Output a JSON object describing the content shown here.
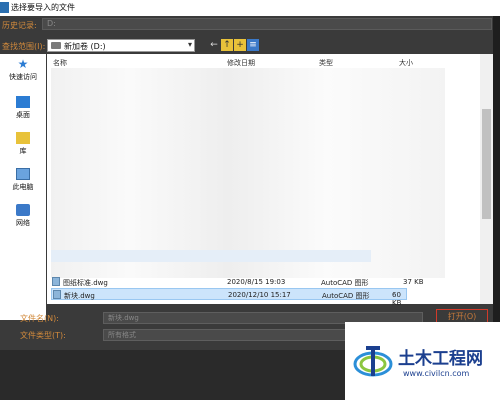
{
  "window": {
    "title": "选择要导入的文件"
  },
  "history": {
    "label": "历史记录:",
    "value": "D:"
  },
  "lookin": {
    "label": "查找范围(I):",
    "value": "新加卷 (D:)"
  },
  "toolbar": {
    "back": "←",
    "up": "↑",
    "new_folder": "+",
    "views": "≡"
  },
  "places": [
    {
      "label": "快速访问",
      "icon": "star-icon"
    },
    {
      "label": "桌面",
      "icon": "desktop-icon"
    },
    {
      "label": "库",
      "icon": "library-icon"
    },
    {
      "label": "此电脑",
      "icon": "computer-icon"
    },
    {
      "label": "网络",
      "icon": "network-icon"
    }
  ],
  "columns": {
    "name": "名称",
    "modified": "修改日期",
    "type": "类型",
    "size": "大小"
  },
  "files": [
    {
      "name": "图纸标准.dwg",
      "modified": "2020/8/15 19:03",
      "type": "AutoCAD 图形",
      "size": "37 KB"
    },
    {
      "name": "新块.dwg",
      "modified": "2020/12/10 15:17",
      "type": "AutoCAD 图形",
      "size": "60 KB"
    }
  ],
  "filename": {
    "label": "文件名(N):",
    "value": "新块.dwg"
  },
  "filetype": {
    "label": "文件类型(T):",
    "value": "所有格式"
  },
  "buttons": {
    "open": "打开(O)"
  },
  "watermark": {
    "title": "土木工程网",
    "url": "www.civilcn.com"
  },
  "colors": {
    "accent_orange": "#d28a3c",
    "selection": "#cce4fb",
    "brand_blue": "#1b3f8f"
  }
}
